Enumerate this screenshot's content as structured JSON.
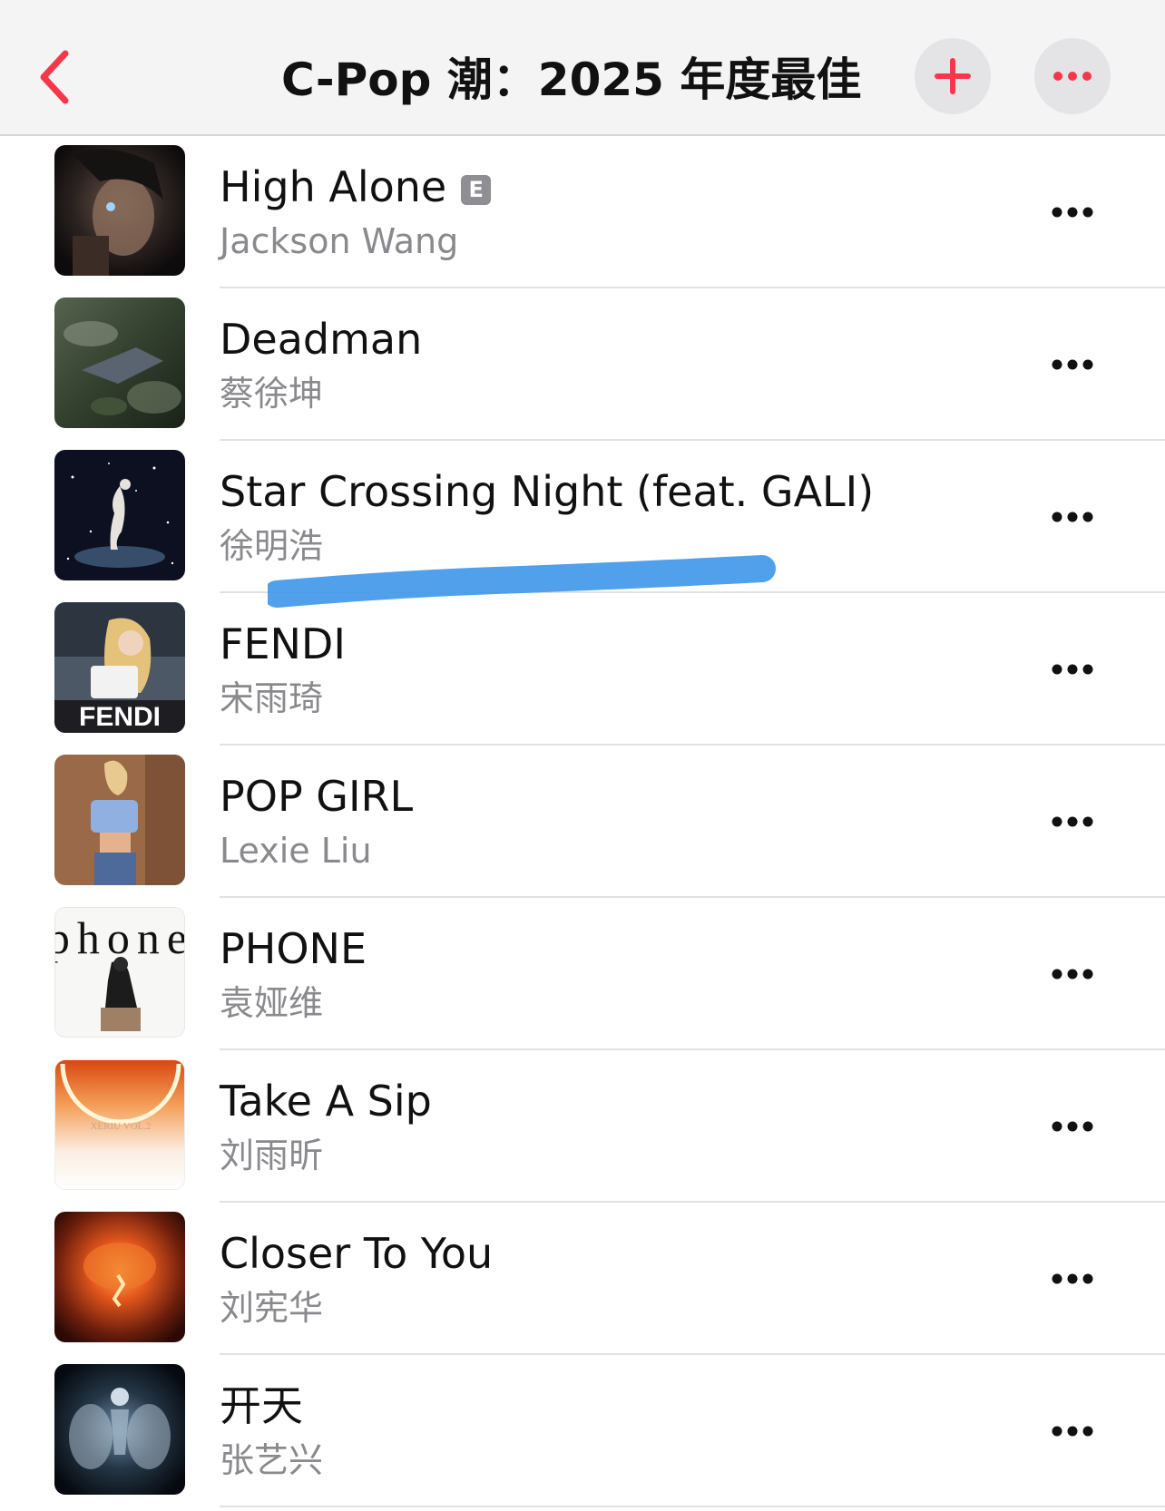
{
  "colors": {
    "accent": "#f5374a",
    "navbar_bg": "#f4f4f5",
    "secondary_text": "#8a8a8e",
    "scribble": "#3d96ea"
  },
  "nav": {
    "back_icon": "chevron-left-icon",
    "title": "C-Pop 潮：2025 年度最佳",
    "add_icon": "plus-icon",
    "more_icon": "ellipsis-icon"
  },
  "tracks": [
    {
      "title": "High Alone",
      "artist": "Jackson Wang",
      "explicit": true,
      "explicit_label": "E"
    },
    {
      "title": "Deadman",
      "artist": "蔡徐坤"
    },
    {
      "title": "Star Crossing Night (feat. GALI)",
      "artist": "徐明浩"
    },
    {
      "title": "FENDI",
      "artist": "宋雨琦",
      "artwork_text": "FENDI"
    },
    {
      "title": "POP GIRL",
      "artist": "Lexie Liu"
    },
    {
      "title": "PHONE",
      "artist": "袁娅维",
      "artwork_text": "phone"
    },
    {
      "title": "Take A Sip",
      "artist": "刘雨昕",
      "artwork_text": "XERIU VOL.2"
    },
    {
      "title": "Closer To You",
      "artist": "刘宪华"
    },
    {
      "title": "开天",
      "artist": "张艺兴"
    }
  ]
}
